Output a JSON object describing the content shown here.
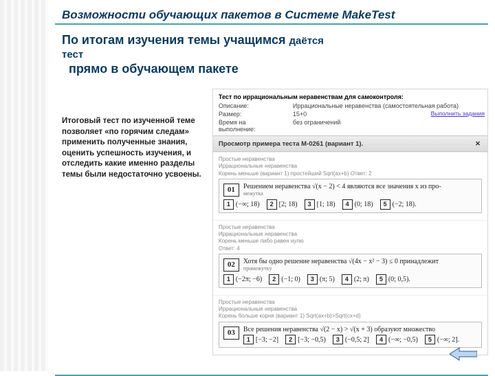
{
  "title": "Возможности обучающих пакетов в Системе MakeTest",
  "subtitle": {
    "line1": "По итогам изучения темы учащимся",
    "line1_tail": "даётся",
    "line_test": "тест",
    "line2": "прямо в обучающем пакете"
  },
  "description": "Итоговый тест по изученной теме позволяет «по горячим следам» применить полученные знания,  оценить успешность изучения, и отследить какие именно разделы темы были недостаточно усвоены.",
  "app": {
    "header_title": "Тест по иррациональным неравенствам для самоконтроля:",
    "meta": [
      {
        "k": "Описание:",
        "v": "Иррациональные неравенства (самостоятельная работа)"
      },
      {
        "k": "Размер:",
        "v": "15+0"
      },
      {
        "k": "Время на выполнение:",
        "v": "без ограничений"
      }
    ],
    "link": "Выполнить задания",
    "bar": "Просмотр примера теста М-0261 (вариант 1).",
    "questions": [
      {
        "tags": [
          "Простые неравенства",
          "Иррациональные неравенства",
          "Корень меньше (вариант 1) простейший Sqrt(ax+b) Ответ: 2"
        ],
        "num": "01",
        "stem_html": "Решением неравенства √(x − 2) < 4 являются все значения x из про-",
        "sub": "межутка",
        "opts": [
          {
            "k": "1",
            "t": "(−∞; 18)"
          },
          {
            "k": "2",
            "t": "[2; 18)"
          },
          {
            "k": "3",
            "t": "[1; 18)"
          },
          {
            "k": "4",
            "t": "(0; 18)"
          },
          {
            "k": "5",
            "t": "(−2; 18)."
          }
        ]
      },
      {
        "tags": [
          "Простые неравенства",
          "Иррациональные неравенства",
          "Корень меньше либо равен нулю",
          "Ответ: 4"
        ],
        "num": "02",
        "stem_html": "Хотя бы одно решение неравенства √(4x − x² − 3) ≤ 0 принадлежит",
        "sub": "промежутку",
        "opts": [
          {
            "k": "1",
            "t": "(−2π; −6)"
          },
          {
            "k": "2",
            "t": "(−1; 0)"
          },
          {
            "k": "3",
            "t": "(π; 5)"
          },
          {
            "k": "4",
            "t": "(2; π)"
          },
          {
            "k": "5",
            "t": "(0; 0,5)."
          }
        ]
      },
      {
        "tags": [
          "Простые неравенства",
          "Иррациональные неравенства",
          "Корень больше корня (вариант 1) Sqrt(ax+b)>Sqrt(cx+d)"
        ],
        "num": "03",
        "stem_html": "Все решения неравенства √(2 − x) > √(x + 3) образуют множество",
        "sub": "",
        "opts": [
          {
            "k": "1",
            "t": "[−3; −2]"
          },
          {
            "k": "2",
            "t": "[−3; −0,5)"
          },
          {
            "k": "3",
            "t": "(−0,5; 2]"
          },
          {
            "k": "4",
            "t": "(−∞; −0,5)"
          },
          {
            "k": "5",
            "t": "(−∞; 2]."
          }
        ]
      }
    ]
  }
}
